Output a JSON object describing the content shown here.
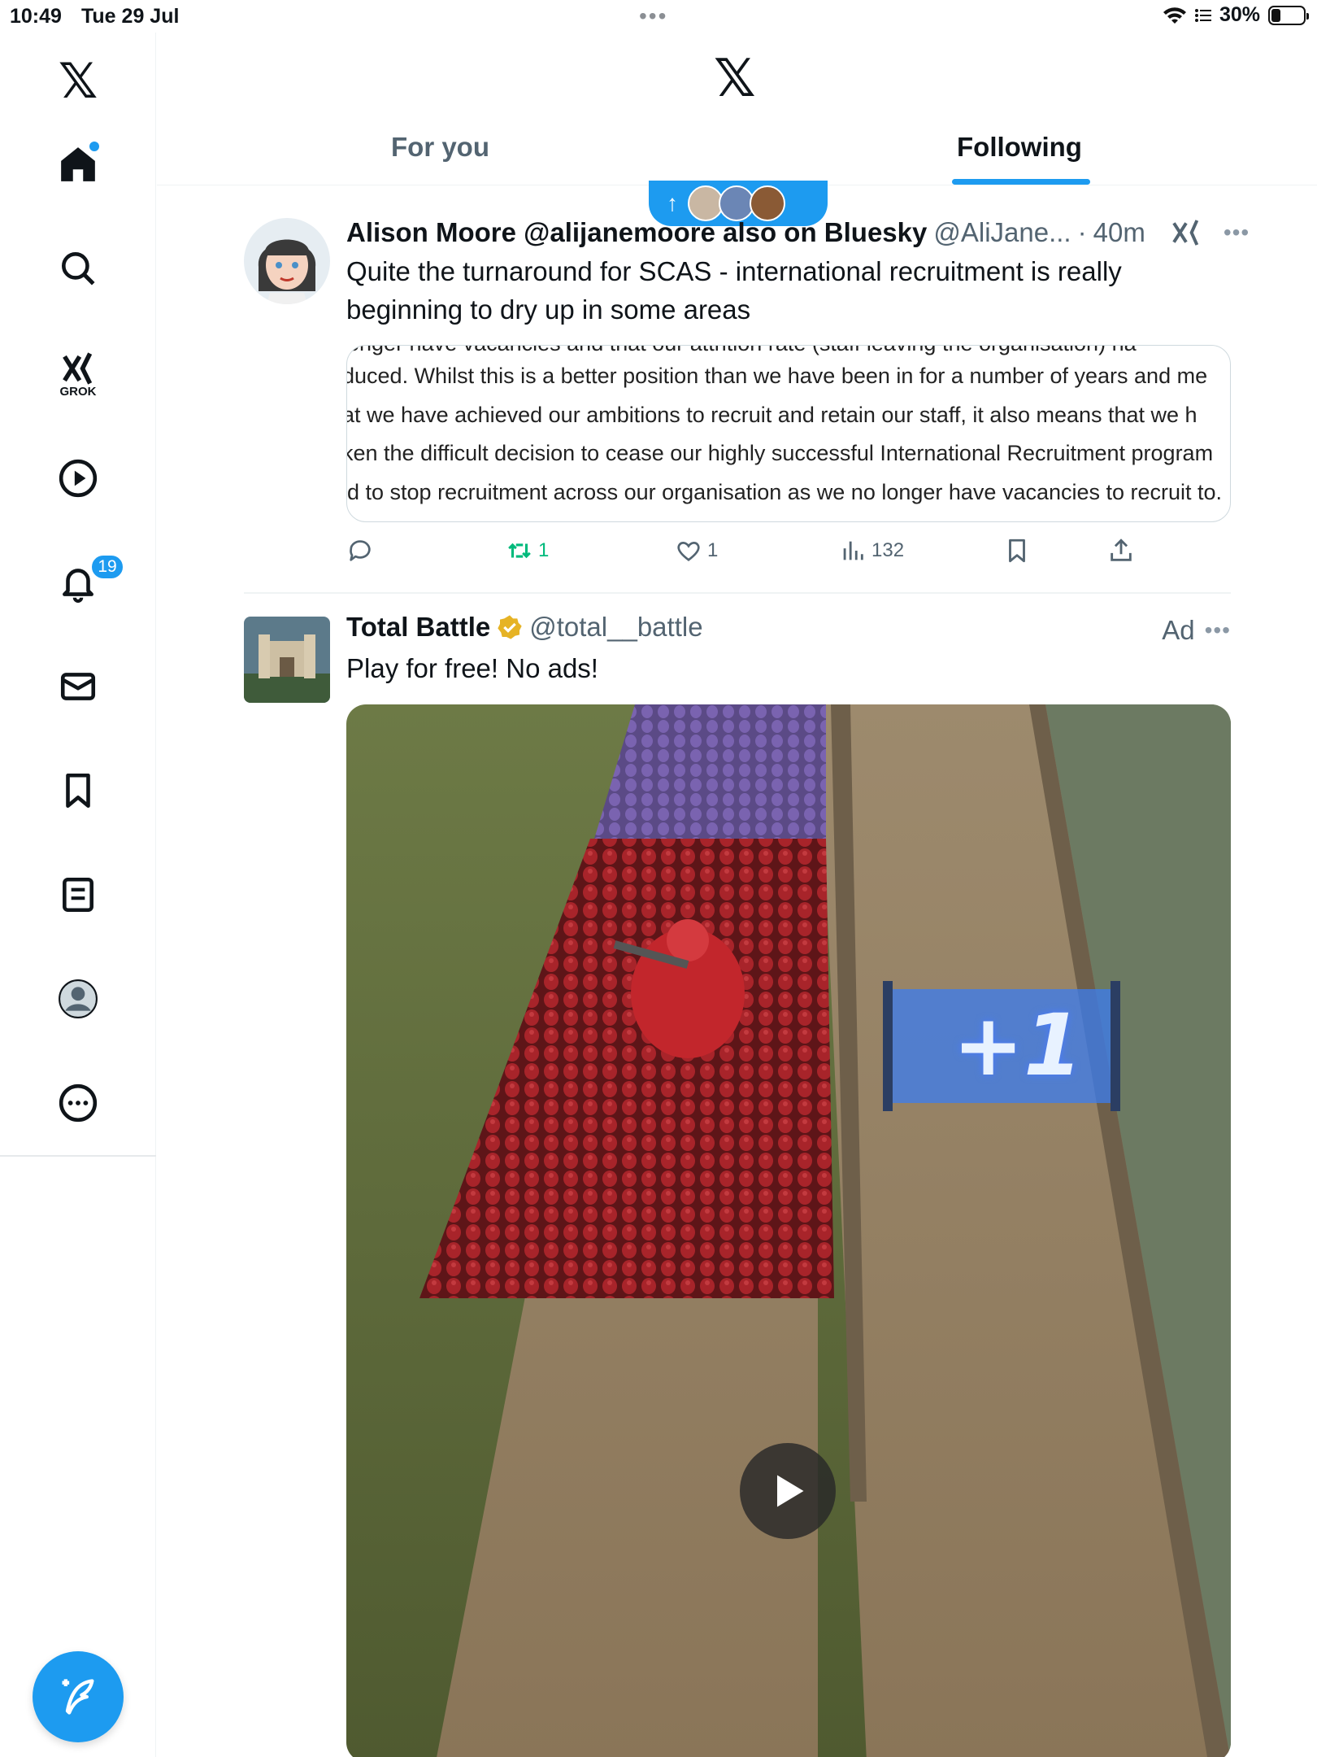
{
  "status_bar": {
    "time": "10:49",
    "date": "Tue 29 Jul",
    "battery": "30%",
    "battery_level": 0.3
  },
  "sidebar": {
    "grok_label": "GROK",
    "notifications_count": "19"
  },
  "header": {
    "logo": "𝕏",
    "tabs": [
      {
        "label": "For you",
        "active": false
      },
      {
        "label": "Following",
        "active": true
      }
    ]
  },
  "posts": [
    {
      "name": "Alison Moore @alijanemoore also on Bluesky",
      "handle": "@AliJane...",
      "sep": "·",
      "time": "40m",
      "text": "Quite the turnaround for SCAS - international recruitment is really beginning to dry up in some areas",
      "quote_lines": [
        "longer have vacancies and that our attrition rate (staff leaving the organisation) ha",
        "duced. Whilst this is a better position than we have been in for a number of years and me",
        "at we have achieved our ambitions to recruit and retain our staff, it also means that we h",
        "ken the difficult decision to cease our highly successful International Recruitment program",
        "d to stop recruitment across our organisation as we no longer have vacancies to recruit to."
      ],
      "reposts": "1",
      "likes": "1",
      "views": "132"
    },
    {
      "name": "Total Battle",
      "handle": "@total__battle",
      "ad_label": "Ad",
      "text": "Play for free! No ads!",
      "video_overlay": "+1"
    }
  ],
  "colors": {
    "accent": "#1d9bf0",
    "repost": "#00ba7c",
    "muted": "#536471"
  }
}
